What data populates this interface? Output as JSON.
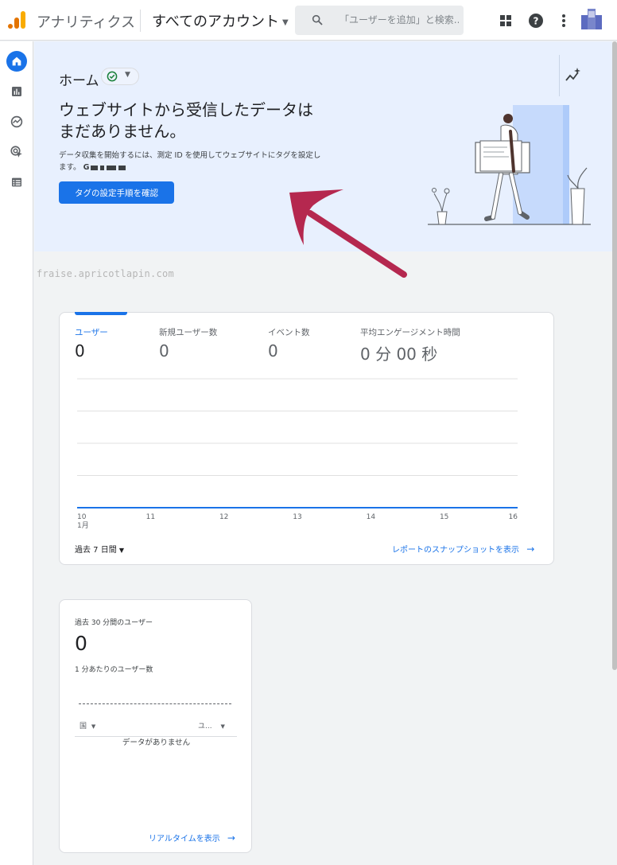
{
  "app": {
    "name": "アナリティクス",
    "account_selector": "すべてのアカウント"
  },
  "search": {
    "placeholder": "「ユーザーを追加」と検索..."
  },
  "hero": {
    "title": "ホーム",
    "heading": "ウェブサイトから受信したデータはまだありません。",
    "description": "データ収集を開始するには、測定 ID を使用してウェブサイトにタグを設定します。",
    "measurement_id_prefix": "G",
    "cta_label": "タグの設定手順を確認"
  },
  "watermark": "fraise.apricotlapin.com",
  "overview": {
    "metrics": [
      {
        "label": "ユーザー",
        "value": "0"
      },
      {
        "label": "新規ユーザー数",
        "value": "0"
      },
      {
        "label": "イベント数",
        "value": "0"
      },
      {
        "label": "平均エンゲージメント時間",
        "value": "0 分 00 秒"
      }
    ],
    "date_range": "過去 7 日間",
    "snapshot_link": "レポートのスナップショットを表示"
  },
  "chart_data": {
    "type": "line",
    "x": [
      "10",
      "11",
      "12",
      "13",
      "14",
      "15",
      "16"
    ],
    "x_month_label": "1月",
    "series": [
      {
        "values": [
          0,
          0,
          0,
          0,
          0,
          0,
          0
        ]
      }
    ],
    "title": "",
    "xlabel": "",
    "ylabel": "",
    "grid": true,
    "color": "#1a73e8"
  },
  "realtime": {
    "label": "過去 30 分間のユーザー",
    "value": "0",
    "sub_label": "1 分あたりのユーザー数",
    "column_country": "国",
    "column_users": "ユ...",
    "empty": "データがありません",
    "link": "リアルタイムを表示"
  },
  "colors": {
    "accent": "#1a73e8",
    "arrow": "#b5284f",
    "hero_bg": "#e8f0fe"
  }
}
